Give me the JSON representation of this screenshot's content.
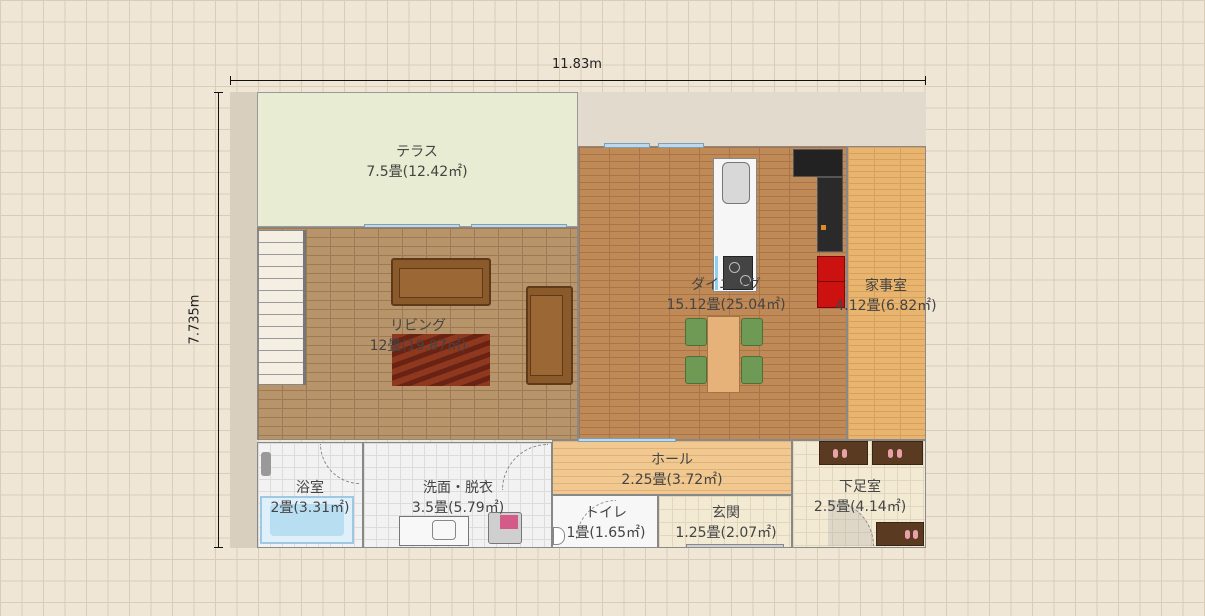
{
  "dimensions": {
    "width_label": "11.83m",
    "height_label": "7.735m"
  },
  "rooms": {
    "terrace": {
      "name": "テラス",
      "area": "7.5畳(12.42㎡)"
    },
    "living": {
      "name": "リビング",
      "area": "12畳(19.87㎡)"
    },
    "dining": {
      "name": "ダイニング",
      "area": "15.12畳(25.04㎡)"
    },
    "kaji": {
      "name": "家事室",
      "area": "4.12畳(6.82㎡)"
    },
    "bath": {
      "name": "浴室",
      "area": "2畳(3.31㎡)"
    },
    "wash": {
      "name": "洗面・脱衣",
      "area": "3.5畳(5.79㎡)"
    },
    "hall": {
      "name": "ホール",
      "area": "2.25畳(3.72㎡)"
    },
    "toilet": {
      "name": "トイレ",
      "area": "1畳(1.65㎡)"
    },
    "genkan": {
      "name": "玄関",
      "area": "1.25畳(2.07㎡)"
    },
    "shoe": {
      "name": "下足室",
      "area": "2.5畳(4.14㎡)"
    }
  },
  "colors": {
    "terrace": "#e8ecd2",
    "sofa": "#8a5a2b",
    "rug": "#7a2a18",
    "chair": "#6f9a55",
    "table": "#e6b27a",
    "fridge": "#cc1111",
    "range": "#222222"
  }
}
